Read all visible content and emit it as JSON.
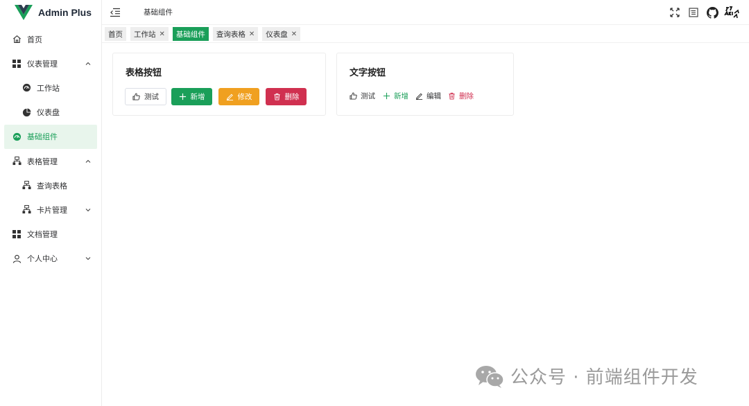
{
  "app": {
    "brand": "Admin Plus"
  },
  "header": {
    "breadcrumb": "基础组件"
  },
  "sidebar": {
    "items": [
      {
        "label": "首页",
        "icon": "home-icon"
      },
      {
        "label": "仪表管理",
        "icon": "grid-icon",
        "expanded": true
      },
      {
        "label": "工作站",
        "icon": "gauge-icon"
      },
      {
        "label": "仪表盘",
        "icon": "pie-icon"
      },
      {
        "label": "基础组件",
        "icon": "gauge-icon",
        "active": true
      },
      {
        "label": "表格管理",
        "icon": "hierarchy-icon",
        "expanded": true
      },
      {
        "label": "查询表格",
        "icon": "hierarchy-icon"
      },
      {
        "label": "卡片管理",
        "icon": "hierarchy-icon",
        "expanded": false
      },
      {
        "label": "文档管理",
        "icon": "grid-icon"
      },
      {
        "label": "个人中心",
        "icon": "user-icon",
        "expanded": false
      }
    ]
  },
  "tags": [
    {
      "label": "首页",
      "closable": false
    },
    {
      "label": "工作站",
      "closable": true
    },
    {
      "label": "基础组件",
      "closable": false,
      "active": true
    },
    {
      "label": "查询表格",
      "closable": true
    },
    {
      "label": "仪表盘",
      "closable": true
    }
  ],
  "cards": {
    "table_buttons": {
      "title": "表格按钮",
      "test": "测试",
      "add": "新增",
      "edit": "修改",
      "delete": "删除"
    },
    "text_buttons": {
      "title": "文字按钮",
      "test": "测试",
      "add": "新增",
      "edit": "编辑",
      "delete": "删除"
    }
  },
  "watermark": {
    "text": "公众号 · 前端组件开发"
  },
  "colors": {
    "primary": "#1a9f59",
    "warning": "#f0a020",
    "danger": "#d03050"
  }
}
